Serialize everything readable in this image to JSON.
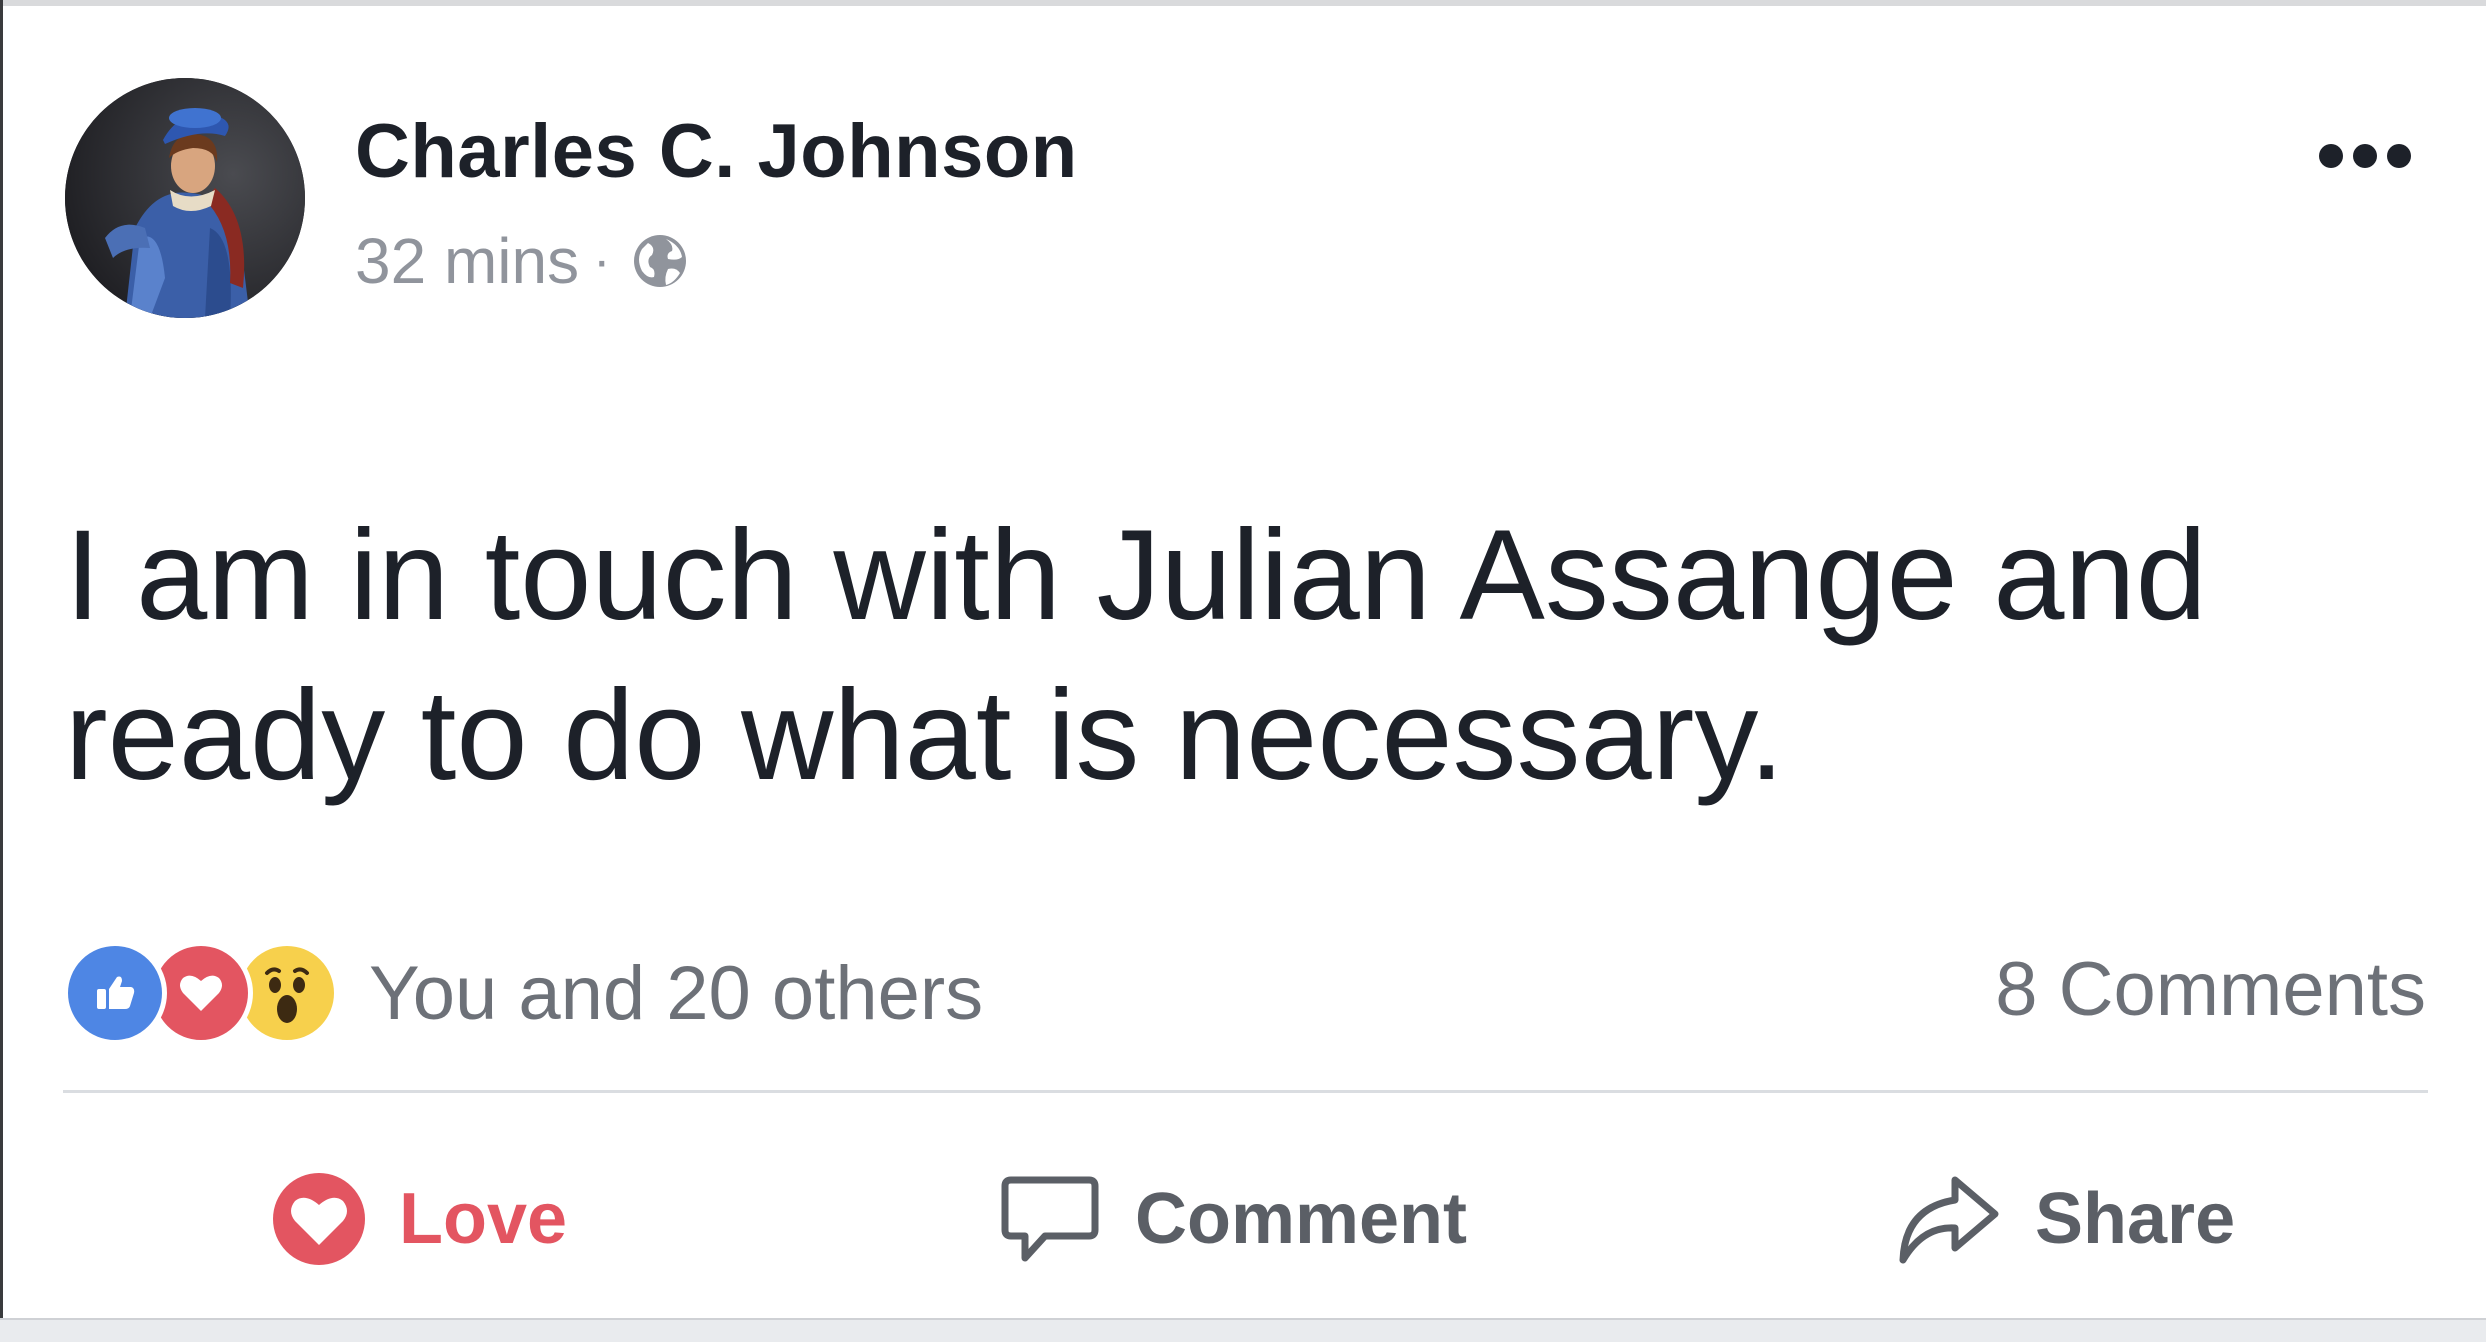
{
  "post": {
    "author": "Charles C. Johnson",
    "timestamp": "32 mins",
    "separator": "·",
    "privacy_icon": "globe-icon",
    "more_icon": "more-options-icon",
    "text_line1": "I am in touch with Julian Assange and",
    "text_line2": "ready to do what is necessary."
  },
  "reactions": {
    "icons": [
      "like-reaction-icon",
      "love-reaction-icon",
      "wow-reaction-icon"
    ],
    "summary": "You and 20 others",
    "comments": "8 Comments"
  },
  "actions": {
    "love_label": "Love",
    "comment_label": "Comment",
    "share_label": "Share"
  },
  "colors": {
    "text": "#1d2129",
    "meta": "#90949c",
    "like_blue": "#4e86e4",
    "love_red": "#e35561",
    "wow_yellow": "#f7d04c",
    "action_gray": "#5b5f66"
  }
}
